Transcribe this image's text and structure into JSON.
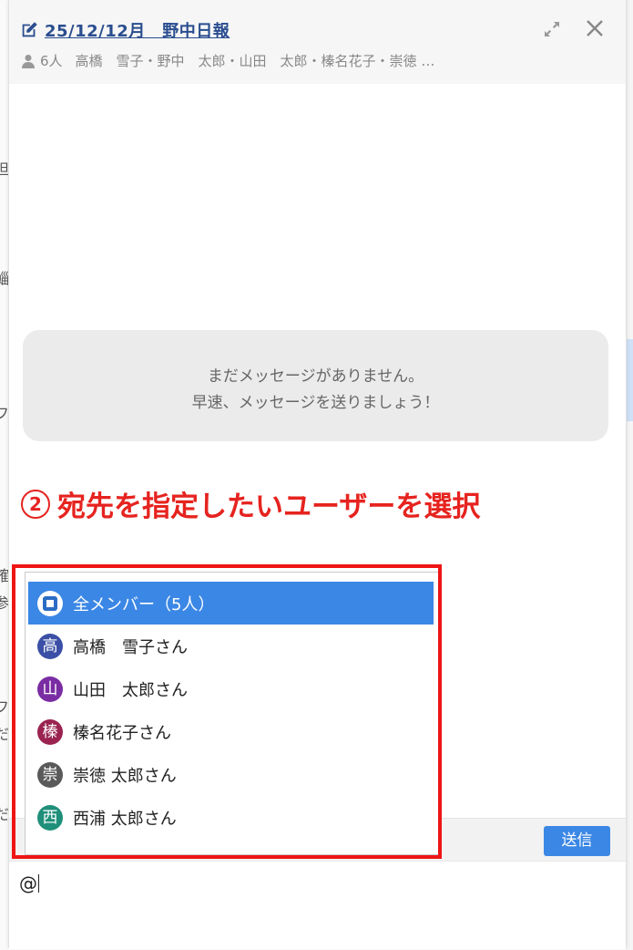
{
  "header": {
    "title": "25/12/12月　野中日報",
    "member_count": "6人",
    "members": "高橋　雪子・野中　太郎・山田　太郎・榛名花子・崇徳 …"
  },
  "background_fragments": [
    "担",
    "鯔",
    "フ",
    "確",
    "参",
    "フ",
    "だ",
    "だ"
  ],
  "empty_message": {
    "line1": "まだメッセージがありません。",
    "line2": "早速、メッセージを送りましょう！"
  },
  "annotation": {
    "number": "2",
    "text": "宛先を指定したいユーザーを選択"
  },
  "mention_dropdown": {
    "items": [
      {
        "avatar": "",
        "label": "全メンバー（5人）",
        "color": "#3b87e5",
        "selected": true
      },
      {
        "avatar": "高",
        "label": "高橋　雪子さん",
        "color": "#3a4fa5",
        "selected": false
      },
      {
        "avatar": "山",
        "label": "山田　太郎さん",
        "color": "#7a2da3",
        "selected": false
      },
      {
        "avatar": "榛",
        "label": "榛名花子さん",
        "color": "#9a2350",
        "selected": false
      },
      {
        "avatar": "崇",
        "label": "崇徳 太郎さん",
        "color": "#5a5a5a",
        "selected": false
      },
      {
        "avatar": "西",
        "label": "西浦 太郎さん",
        "color": "#1f8f7a",
        "selected": false
      }
    ]
  },
  "composer": {
    "send_label": "送信",
    "input_value": "@"
  },
  "colors": {
    "accent": "#3b87e5",
    "annotation_red": "#e6231f",
    "title_link": "#2a4d8f"
  },
  "icons": [
    "edit-icon",
    "expand-icon",
    "close-icon",
    "person-icon",
    "all-members-icon"
  ]
}
